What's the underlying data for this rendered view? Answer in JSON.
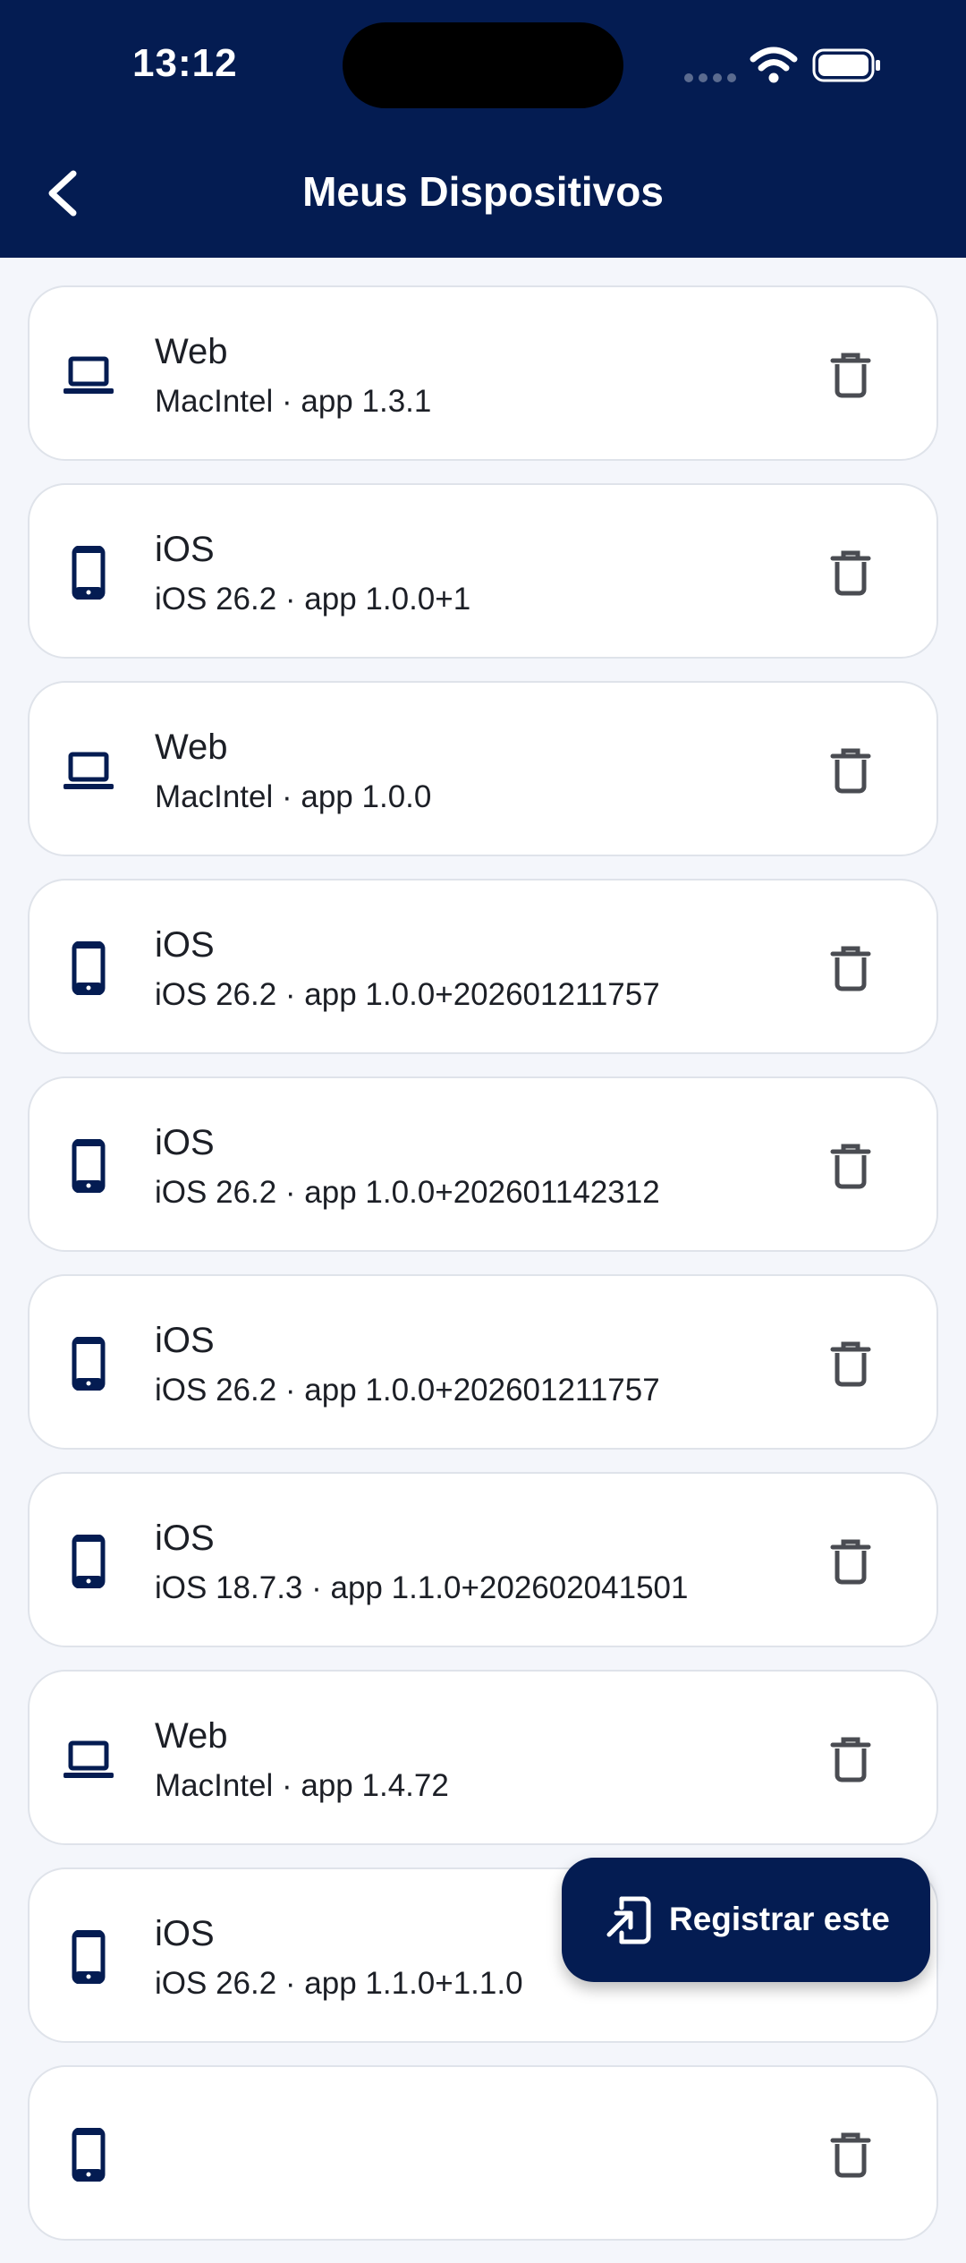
{
  "status_bar": {
    "time": "13:12"
  },
  "header": {
    "title": "Meus Dispositivos"
  },
  "devices": [
    {
      "type": "laptop",
      "name": "Web",
      "detail": "MacIntel · app 1.3.1"
    },
    {
      "type": "phone",
      "name": "iOS",
      "detail": "iOS 26.2 · app 1.0.0+1"
    },
    {
      "type": "laptop",
      "name": "Web",
      "detail": "MacIntel · app 1.0.0"
    },
    {
      "type": "phone",
      "name": "iOS",
      "detail": "iOS 26.2 · app 1.0.0+202601211757"
    },
    {
      "type": "phone",
      "name": "iOS",
      "detail": "iOS 26.2 · app 1.0.0+202601142312"
    },
    {
      "type": "phone",
      "name": "iOS",
      "detail": "iOS 26.2 · app 1.0.0+202601211757"
    },
    {
      "type": "phone",
      "name": "iOS",
      "detail": "iOS 18.7.3 · app 1.1.0+202602041501"
    },
    {
      "type": "laptop",
      "name": "Web",
      "detail": "MacIntel · app 1.4.72"
    },
    {
      "type": "phone",
      "name": "iOS",
      "detail": "iOS 26.2 · app 1.1.0+1.1.0"
    },
    {
      "type": "phone",
      "name": "",
      "detail": ""
    }
  ],
  "icons": {
    "laptop": "laptop-icon",
    "phone": "smartphone-icon",
    "delete": "trash-icon",
    "register": "register-device-icon"
  },
  "fab": {
    "label": "Registrar este"
  },
  "colors": {
    "primary": "#041c52",
    "background": "#f4f6fb",
    "card_border": "#dfe3ea",
    "delete_icon": "#4a4c52"
  }
}
